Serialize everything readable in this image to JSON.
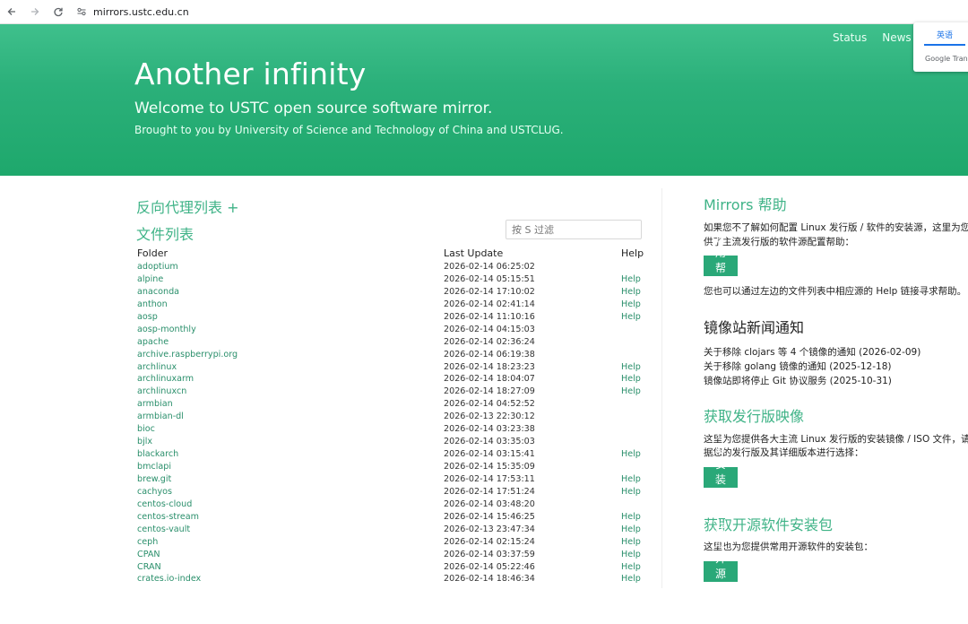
{
  "browser": {
    "url": "mirrors.ustc.edu.cn"
  },
  "nav": {
    "status": "Status",
    "news": "News"
  },
  "translate": {
    "language": "英语",
    "brand": "Google Trans"
  },
  "hero": {
    "title": "Another infinity",
    "subtitle": "Welcome to USTC open source software mirror.",
    "tagline": "Brought to you by University of Science and Technology of China and USTCLUG."
  },
  "left": {
    "proxy_heading": "反向代理列表 +",
    "files_heading": "文件列表",
    "filter_placeholder": "按 S 过滤",
    "columns": {
      "folder": "Folder",
      "last_update": "Last Update",
      "help": "Help"
    },
    "files": [
      {
        "name": "adoptium",
        "date": "2026-02-14 06:25:02",
        "help": ""
      },
      {
        "name": "alpine",
        "date": "2026-02-14 05:15:51",
        "help": "Help"
      },
      {
        "name": "anaconda",
        "date": "2026-02-14 17:10:02",
        "help": "Help"
      },
      {
        "name": "anthon",
        "date": "2026-02-14 02:41:14",
        "help": "Help"
      },
      {
        "name": "aosp",
        "date": "2026-02-14 11:10:16",
        "help": "Help"
      },
      {
        "name": "aosp-monthly",
        "date": "2026-02-14 04:15:03",
        "help": ""
      },
      {
        "name": "apache",
        "date": "2026-02-14 02:36:24",
        "help": ""
      },
      {
        "name": "archive.raspberrypi.org",
        "date": "2026-02-14 06:19:38",
        "help": ""
      },
      {
        "name": "archlinux",
        "date": "2026-02-14 18:23:23",
        "help": "Help"
      },
      {
        "name": "archlinuxarm",
        "date": "2026-02-14 18:04:07",
        "help": "Help"
      },
      {
        "name": "archlinuxcn",
        "date": "2026-02-14 18:27:09",
        "help": "Help"
      },
      {
        "name": "armbian",
        "date": "2026-02-14 04:52:52",
        "help": ""
      },
      {
        "name": "armbian-dl",
        "date": "2026-02-13 22:30:12",
        "help": ""
      },
      {
        "name": "bioc",
        "date": "2026-02-14 03:23:38",
        "help": ""
      },
      {
        "name": "bjlx",
        "date": "2026-02-14 03:35:03",
        "help": ""
      },
      {
        "name": "blackarch",
        "date": "2026-02-14 03:15:41",
        "help": "Help"
      },
      {
        "name": "bmclapi",
        "date": "2026-02-14 15:35:09",
        "help": ""
      },
      {
        "name": "brew.git",
        "date": "2026-02-14 17:53:11",
        "help": "Help"
      },
      {
        "name": "cachyos",
        "date": "2026-02-14 17:51:24",
        "help": "Help"
      },
      {
        "name": "centos-cloud",
        "date": "2026-02-14 03:48:20",
        "help": ""
      },
      {
        "name": "centos-stream",
        "date": "2026-02-14 15:46:25",
        "help": "Help"
      },
      {
        "name": "centos-vault",
        "date": "2026-02-13 23:47:34",
        "help": "Help"
      },
      {
        "name": "ceph",
        "date": "2026-02-14 02:15:24",
        "help": "Help"
      },
      {
        "name": "CPAN",
        "date": "2026-02-14 03:37:59",
        "help": "Help"
      },
      {
        "name": "CRAN",
        "date": "2026-02-14 05:22:46",
        "help": "Help"
      },
      {
        "name": "crates.io-index",
        "date": "2026-02-14 18:46:34",
        "help": "Help"
      }
    ]
  },
  "right": {
    "help_heading": "Mirrors 帮助",
    "help_text_1": "如果您不了解如何配置 Linux 发行版 / 软件的安装源，这里为您",
    "help_text_2": "供了主流发行版的软件源配置帮助：",
    "help_button": "使用帮助 >",
    "help_text_3": "您也可以通过左边的文件列表中相应源的 Help 链接寻求帮助。",
    "news_heading": "镜像站新闻通知",
    "news": [
      "关于移除 clojars 等 4 个镜像的通知 (2026-02-09)",
      "关于移除 golang 镜像的通知 (2025-12-18)",
      "镜像站即将停止 Git 协议服务 (2025-10-31)"
    ],
    "iso_heading": "获取发行版映像",
    "iso_text_1": "这里为您提供各大主流 Linux 发行版的安装镜像 / ISO 文件，请",
    "iso_text_2": "据您的发行版及其详细版本进行选择：",
    "iso_button": "获取安装镜像 >",
    "pkg_heading": "获取开源软件安装包",
    "pkg_text": "这里也为您提供常用开源软件的安装包：",
    "pkg_button": "获取开源软件 >"
  }
}
